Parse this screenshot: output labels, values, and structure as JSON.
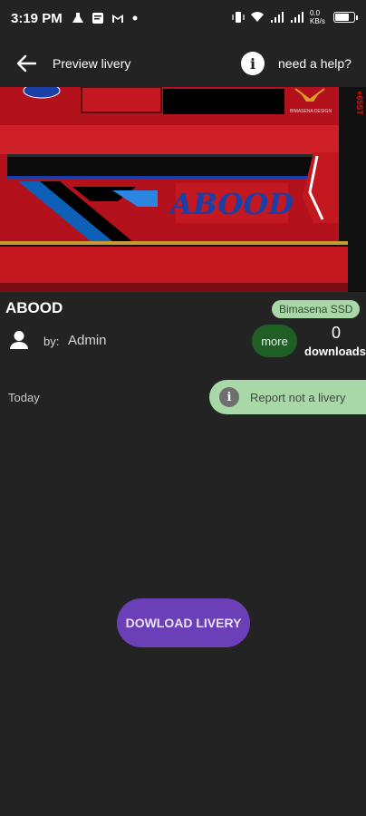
{
  "status_bar": {
    "time": "3:19 PM",
    "left_icons": [
      "flask-icon",
      "note-icon",
      "gmail-icon",
      "dot-icon"
    ],
    "right_icons": [
      "vibrate-icon",
      "wifi-icon",
      "signal-icon",
      "signal-icon"
    ],
    "net_speed": "0.0 KB/s",
    "battery_level": 0.8
  },
  "toolbar": {
    "title": "Preview livery",
    "help_label": "need a help?",
    "info_glyph": "i"
  },
  "preview": {
    "livery_text": "ABOOD",
    "logo_text": "BIMASENA DESIGN",
    "side_text": "+65ST",
    "colors": {
      "body": "#b3121d",
      "accent_blue": "#0d5fb8",
      "window": "#0b0b0b"
    }
  },
  "livery": {
    "name": "ABOOD",
    "bus_type": "Bimasena SSD",
    "by_label": "by:",
    "author": "Admin",
    "more_label": "more",
    "downloads_count": "0",
    "downloads_label": "downloads",
    "date": "Today",
    "report_label": "Report not a livery",
    "report_glyph": "i",
    "download_label": "DOWLOAD LIVERY"
  },
  "colors": {
    "background": "#232323",
    "chip_green": "#a8d8a8",
    "more_green": "#1f5e24",
    "download_purple": "#6b3fb8"
  }
}
